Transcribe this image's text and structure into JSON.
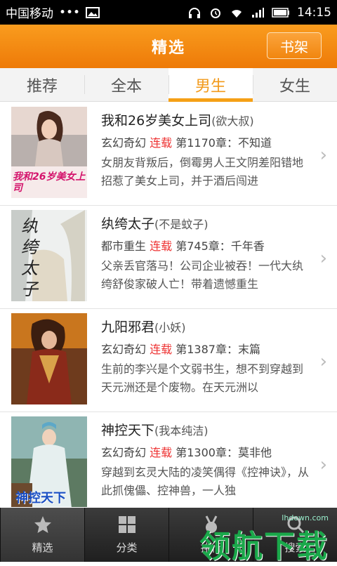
{
  "status": {
    "carrier": "中国移动",
    "dots": "•••",
    "time": "14:15"
  },
  "header": {
    "title": "精选",
    "shelf": "书架"
  },
  "tabs": [
    "推荐",
    "全本",
    "男生",
    "女生"
  ],
  "books": [
    {
      "title": "我和26岁美女上司",
      "author": "(欲大叔)",
      "genre": "玄幻奇幻",
      "status": "连载",
      "chapter": "第1170章：不知道",
      "desc": "女朋友背叛后，倒霉男人王文阴差阳错地招惹了美女上司，并于酒后闯进",
      "cover_text": "我和26岁美女上司"
    },
    {
      "title": "纨绔太子",
      "author": "(不是蚊子)",
      "genre": "都市重生",
      "status": "连载",
      "chapter": "第745章：千年香",
      "desc": "父亲丢官落马！公司企业被吞！一代大纨绔舒俊家破人亡！带着遗憾重生",
      "cover_text": "纨绔太子"
    },
    {
      "title": "九阳邪君",
      "author": "(小妖)",
      "genre": "玄幻奇幻",
      "status": "连载",
      "chapter": "第1387章：末篇",
      "desc": "生前的李兴是个文弱书生，想不到穿越到天元洲还是个废物。在天元洲以",
      "cover_text": ""
    },
    {
      "title": "神控天下",
      "author": "(我本纯洁)",
      "genre": "玄幻奇幻",
      "status": "连载",
      "chapter": "第1300章：莫非他",
      "desc": "穿越到玄灵大陆的凌笑偶得《控神诀》，从此抓傀儡、控神兽，一人独",
      "cover_text": "神控天下"
    }
  ],
  "bottom_nav": [
    "精选",
    "分类",
    "排行",
    "搜索"
  ],
  "watermark": {
    "text": "领航下载",
    "url": "lhdown.com"
  }
}
